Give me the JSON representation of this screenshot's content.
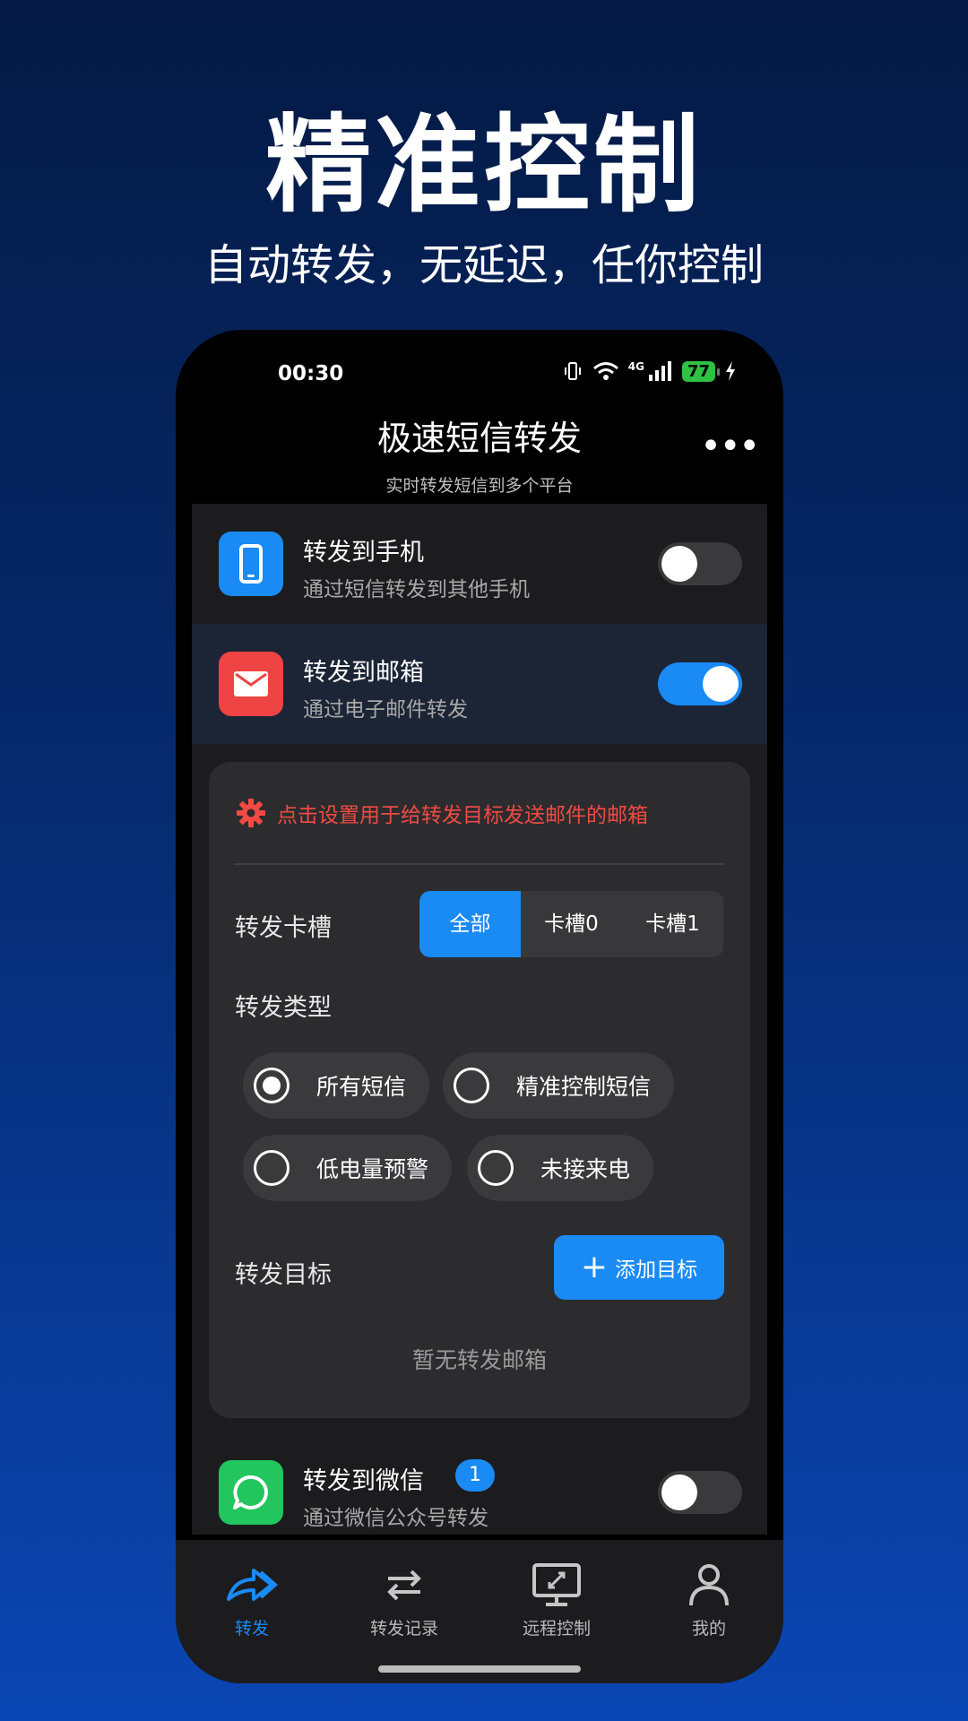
{
  "hero": {
    "title": "精准控制",
    "subtitle": "自动转发，无延迟，任你控制"
  },
  "status_bar": {
    "time": "00:30",
    "network": "4G",
    "battery": "77"
  },
  "app_bar": {
    "title": "极速短信转发",
    "subtitle": "实时转发短信到多个平台"
  },
  "forward_items": [
    {
      "title": "转发到手机",
      "desc": "通过短信转发到其他手机",
      "enabled": false,
      "icon": "phone-icon",
      "color": "#1a8af5"
    },
    {
      "title": "转发到邮箱",
      "desc": "通过电子邮件转发",
      "enabled": true,
      "icon": "mail-icon",
      "color": "#ef4444"
    },
    {
      "title": "转发到微信",
      "desc": "通过微信公众号转发",
      "enabled": false,
      "icon": "chat-icon",
      "color": "#22c55e",
      "badge": "1"
    }
  ],
  "email_panel": {
    "notice": "点击设置用于给转发目标发送邮件的邮箱",
    "sim_label": "转发卡槽",
    "sim_options": [
      "全部",
      "卡槽0",
      "卡槽1"
    ],
    "sim_selected": "全部",
    "type_label": "转发类型",
    "types": [
      {
        "label": "所有短信",
        "checked": true
      },
      {
        "label": "精准控制短信",
        "checked": false
      },
      {
        "label": "低电量预警",
        "checked": false
      },
      {
        "label": "未接来电",
        "checked": false
      }
    ],
    "target_label": "转发目标",
    "add_target": "添加目标",
    "empty_text": "暂无转发邮箱"
  },
  "tabs": [
    {
      "label": "转发",
      "active": true,
      "icon": "forward-icon"
    },
    {
      "label": "转发记录",
      "active": false,
      "icon": "swap-icon"
    },
    {
      "label": "远程控制",
      "active": false,
      "icon": "remote-monitor-icon"
    },
    {
      "label": "我的",
      "active": false,
      "icon": "user-icon"
    }
  ],
  "colors": {
    "accent": "#1a8af5",
    "danger": "#f04a43",
    "success": "#2fc144"
  }
}
